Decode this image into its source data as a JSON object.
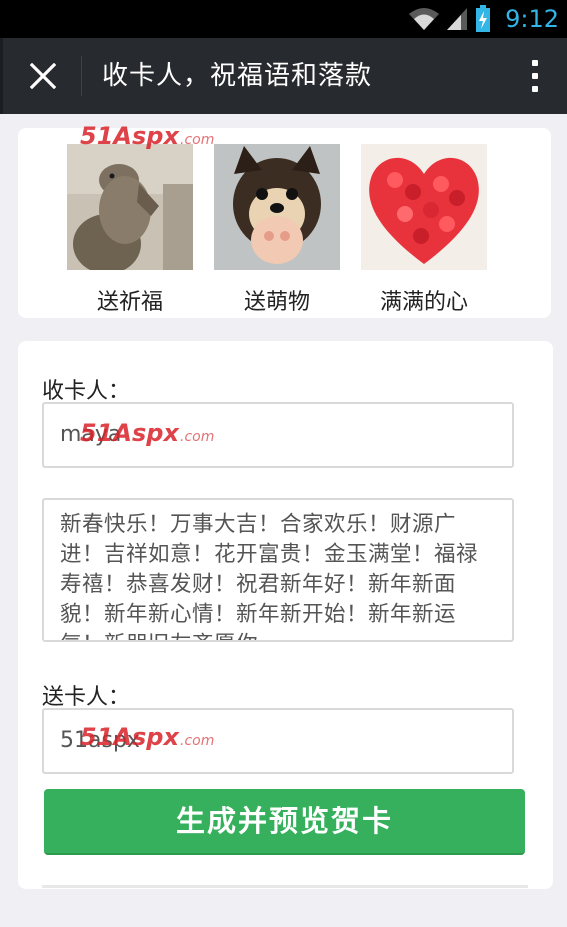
{
  "status_bar": {
    "time": "9:12",
    "icons": [
      "wifi-icon",
      "signal-icon",
      "battery-charging-icon"
    ],
    "time_color": "#33b5e5"
  },
  "app_bar": {
    "title": "收卡人，祝福语和落款",
    "close_icon": "close-icon",
    "more_icon": "more-vertical-icon",
    "background": "#272a2e"
  },
  "gifts": [
    {
      "label": "送祈福",
      "image": "otter-praying-photo"
    },
    {
      "label": "送萌物",
      "image": "puppy-photo"
    },
    {
      "label": "满满的心",
      "image": "rose-heart-photo"
    }
  ],
  "form": {
    "recipient_label": "收卡人：",
    "recipient_value": "maya",
    "message_value": "新春快乐！万事大吉！合家欢乐！财源广进！吉祥如意！花开富贵！金玉满堂！福禄寿禧！恭喜发财！祝君新年好！新年新面貌！新年新心情！新年新开始！新年新运气！新朋旧友齐愿你",
    "sender_label": "送卡人：",
    "sender_value": "51aspx",
    "submit_label": "生成并预览贺卡",
    "submit_color": "#36b05c"
  },
  "watermark": {
    "text_main": "51Aspx",
    "text_suffix": ".com"
  }
}
